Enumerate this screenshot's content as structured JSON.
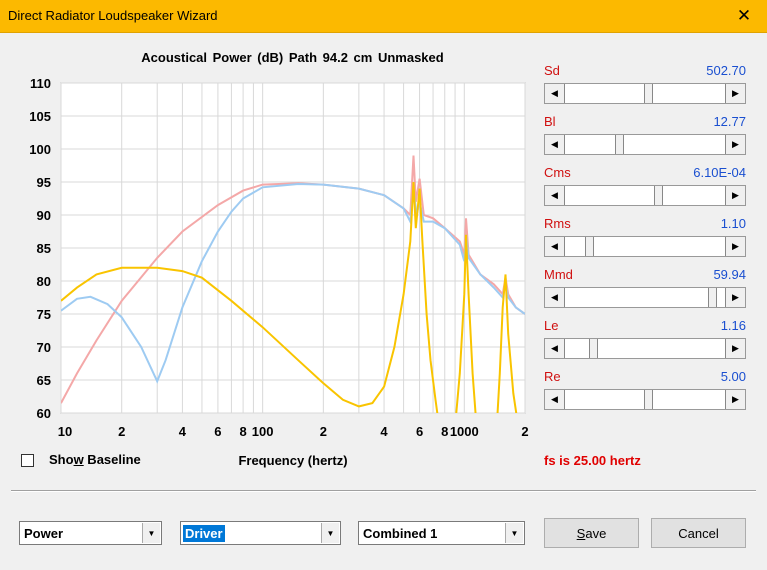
{
  "window": {
    "title": "Direct Radiator Loudspeaker Wizard",
    "close_glyph": "✕"
  },
  "chart_title": "Acoustical Power (dB)   Path 94.2 cm   Unmasked",
  "chart_data": {
    "type": "line",
    "title": "Acoustical Power (dB)   Path 94.2 cm   Unmasked",
    "xlabel": "Frequency (hertz)",
    "ylabel": "",
    "x_scale": "log",
    "xlim": [
      10,
      2000
    ],
    "ylim": [
      60,
      110
    ],
    "y_ticks": [
      "60",
      "65",
      "70",
      "75",
      "80",
      "85",
      "90",
      "95",
      "100",
      "105",
      "110"
    ],
    "x_ticks": [
      {
        "value": 10,
        "label": "10"
      },
      {
        "value": 20,
        "label": "2"
      },
      {
        "value": 40,
        "label": "4"
      },
      {
        "value": 60,
        "label": "6"
      },
      {
        "value": 80,
        "label": "8"
      },
      {
        "value": 100,
        "label": "100"
      },
      {
        "value": 200,
        "label": "2"
      },
      {
        "value": 400,
        "label": "4"
      },
      {
        "value": 600,
        "label": "6"
      },
      {
        "value": 800,
        "label": "8"
      },
      {
        "value": 1000,
        "label": "1000"
      },
      {
        "value": 2000,
        "label": "2"
      }
    ],
    "grid": true,
    "series": [
      {
        "color": "#f4a8a8",
        "points": [
          [
            10,
            61.5
          ],
          [
            12,
            66
          ],
          [
            15,
            71
          ],
          [
            20,
            77
          ],
          [
            30,
            83.5
          ],
          [
            40,
            87.5
          ],
          [
            60,
            91.5
          ],
          [
            80,
            93.7
          ],
          [
            100,
            94.6
          ],
          [
            150,
            94.8
          ],
          [
            200,
            94.6
          ],
          [
            300,
            94
          ],
          [
            400,
            93
          ],
          [
            500,
            91
          ],
          [
            540,
            90
          ],
          [
            560,
            99
          ],
          [
            575,
            92
          ],
          [
            600,
            95.5
          ],
          [
            630,
            90
          ],
          [
            700,
            89.5
          ],
          [
            800,
            88
          ],
          [
            950,
            86
          ],
          [
            1000,
            84
          ],
          [
            1020,
            89.5
          ],
          [
            1050,
            84
          ],
          [
            1200,
            81
          ],
          [
            1400,
            79.5
          ],
          [
            1550,
            78
          ],
          [
            1600,
            80.5
          ],
          [
            1650,
            78
          ],
          [
            1800,
            76
          ],
          [
            2000,
            75
          ]
        ]
      },
      {
        "color": "#9ecbf2",
        "points": [
          [
            10,
            75.5
          ],
          [
            12,
            77.3
          ],
          [
            14,
            77.6
          ],
          [
            17,
            76.5
          ],
          [
            20,
            74.5
          ],
          [
            25,
            70
          ],
          [
            30,
            64.8
          ],
          [
            33,
            68
          ],
          [
            40,
            76
          ],
          [
            50,
            83
          ],
          [
            60,
            87.5
          ],
          [
            70,
            90.5
          ],
          [
            80,
            92.5
          ],
          [
            100,
            94.2
          ],
          [
            150,
            94.7
          ],
          [
            200,
            94.6
          ],
          [
            300,
            94
          ],
          [
            400,
            93
          ],
          [
            500,
            91
          ],
          [
            540,
            89
          ],
          [
            560,
            94
          ],
          [
            580,
            90
          ],
          [
            600,
            92
          ],
          [
            630,
            89
          ],
          [
            700,
            89
          ],
          [
            800,
            88
          ],
          [
            950,
            85.5
          ],
          [
            1000,
            83
          ],
          [
            1020,
            87
          ],
          [
            1050,
            83.5
          ],
          [
            1200,
            81
          ],
          [
            1400,
            79
          ],
          [
            1550,
            77.5
          ],
          [
            1600,
            79.5
          ],
          [
            1650,
            77.5
          ],
          [
            1800,
            76
          ],
          [
            2000,
            75
          ]
        ]
      },
      {
        "color": "#f9c400",
        "points": [
          [
            10,
            77
          ],
          [
            12,
            79
          ],
          [
            15,
            81
          ],
          [
            20,
            82
          ],
          [
            30,
            82
          ],
          [
            40,
            81.5
          ],
          [
            50,
            80.5
          ],
          [
            70,
            77
          ],
          [
            100,
            73
          ],
          [
            150,
            68
          ],
          [
            200,
            64.5
          ],
          [
            250,
            62
          ],
          [
            300,
            61
          ],
          [
            350,
            61.5
          ],
          [
            400,
            64
          ],
          [
            450,
            70
          ],
          [
            500,
            78
          ],
          [
            540,
            86
          ],
          [
            560,
            95
          ],
          [
            575,
            88
          ],
          [
            600,
            94
          ],
          [
            620,
            86
          ],
          [
            650,
            75
          ],
          [
            680,
            68
          ],
          [
            720,
            62
          ],
          [
            750,
            58
          ],
          [
            900,
            58
          ],
          [
            950,
            66
          ],
          [
            1000,
            78
          ],
          [
            1020,
            87
          ],
          [
            1050,
            78
          ],
          [
            1100,
            66
          ],
          [
            1150,
            58
          ],
          [
            1450,
            58
          ],
          [
            1500,
            66
          ],
          [
            1550,
            76
          ],
          [
            1600,
            81
          ],
          [
            1650,
            72
          ],
          [
            1750,
            63
          ],
          [
            1850,
            58
          ]
        ]
      }
    ]
  },
  "x_axis_label": "Frequency (hertz)",
  "params": [
    {
      "name": "Sd",
      "value": "502.70",
      "position": 0.52
    },
    {
      "name": "Bl",
      "value": "12.77",
      "position": 0.33
    },
    {
      "name": "Cms",
      "value": "6.10E-04",
      "position": 0.59
    },
    {
      "name": "Rms",
      "value": "1.10",
      "position": 0.13
    },
    {
      "name": "Mmd",
      "value": "59.94",
      "position": 0.95
    },
    {
      "name": "Le",
      "value": "1.16",
      "position": 0.16
    },
    {
      "name": "Re",
      "value": "5.00",
      "position": 0.52
    }
  ],
  "arrows": {
    "left": "◀",
    "right": "▶",
    "down": "▼"
  },
  "show_baseline": {
    "label_pre": "Sho",
    "label_accel": "w",
    "label_post": " Baseline",
    "checked": false
  },
  "fs_text": "fs is 25.00 hertz",
  "combos": [
    {
      "value": "Power"
    },
    {
      "value": "Driver"
    },
    {
      "value": "Combined 1"
    }
  ],
  "save_pre": "",
  "save_accel": "S",
  "save_post": "ave",
  "cancel_label": "Cancel"
}
